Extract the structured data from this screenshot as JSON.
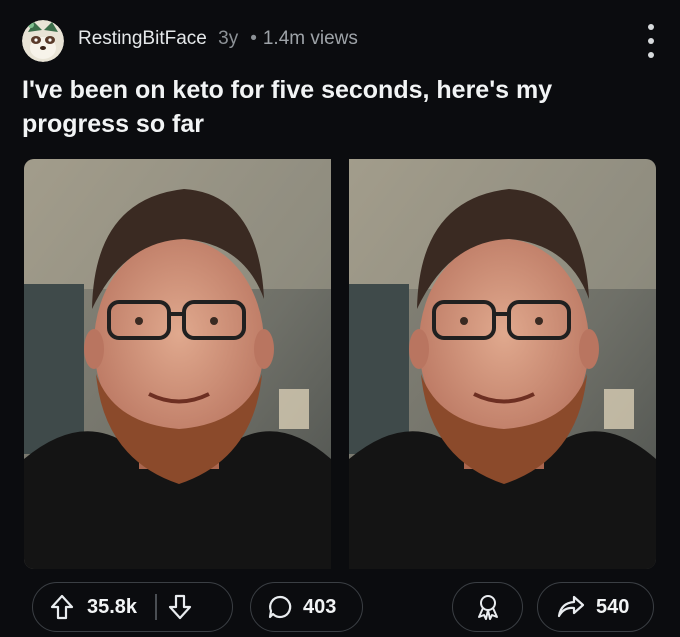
{
  "post": {
    "author": "RestingBitFace",
    "age": "3y",
    "separator": "•",
    "views": "1.4m views",
    "title": "I've been on keto for five seconds, here's my progress so far"
  },
  "images": [
    {
      "icon": "photo-before"
    },
    {
      "icon": "photo-after"
    }
  ],
  "actions": {
    "upvotes": "35.8k",
    "comments": "403",
    "shares": "540"
  },
  "icons": {
    "upvote": "arrow-up-outline",
    "downvote": "arrow-down-outline",
    "comment": "speech-bubble",
    "award": "award-ribbon",
    "share": "share-arrow",
    "more": "vertical-ellipsis"
  },
  "colors": {
    "background": "#0b0c0f",
    "text": "#f2f4f5",
    "muted": "#9ea3a8",
    "pill_border": "#3b3f44"
  }
}
